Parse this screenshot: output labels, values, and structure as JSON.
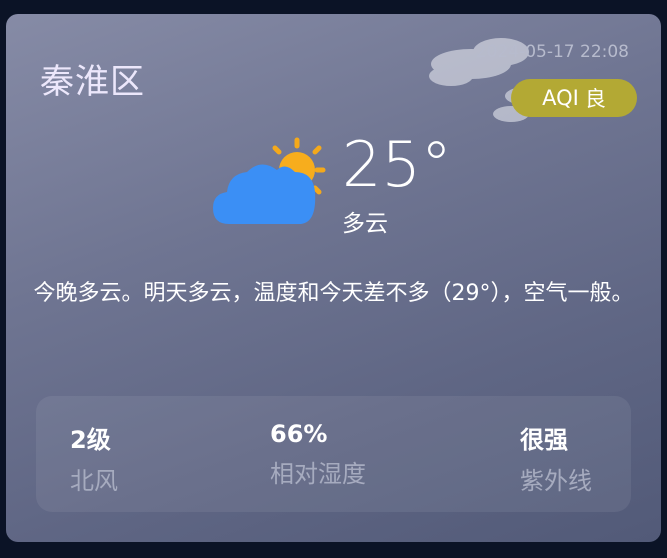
{
  "location": {
    "district": "秦淮区"
  },
  "datetime": "2024-05-17 22:08",
  "aqi": {
    "label": "AQI",
    "level": "良",
    "color": "#b3a934"
  },
  "current": {
    "temperature": "25°",
    "condition": "多云",
    "icon": "cloud-sun-icon"
  },
  "summary": "今晚多云。明天多云，温度和今天差不多（29°），空气一般。",
  "stats": [
    {
      "value": "2级",
      "label": "北风"
    },
    {
      "value": "66%",
      "label": "相对湿度"
    },
    {
      "value": "很强",
      "label": "紫外线"
    }
  ]
}
